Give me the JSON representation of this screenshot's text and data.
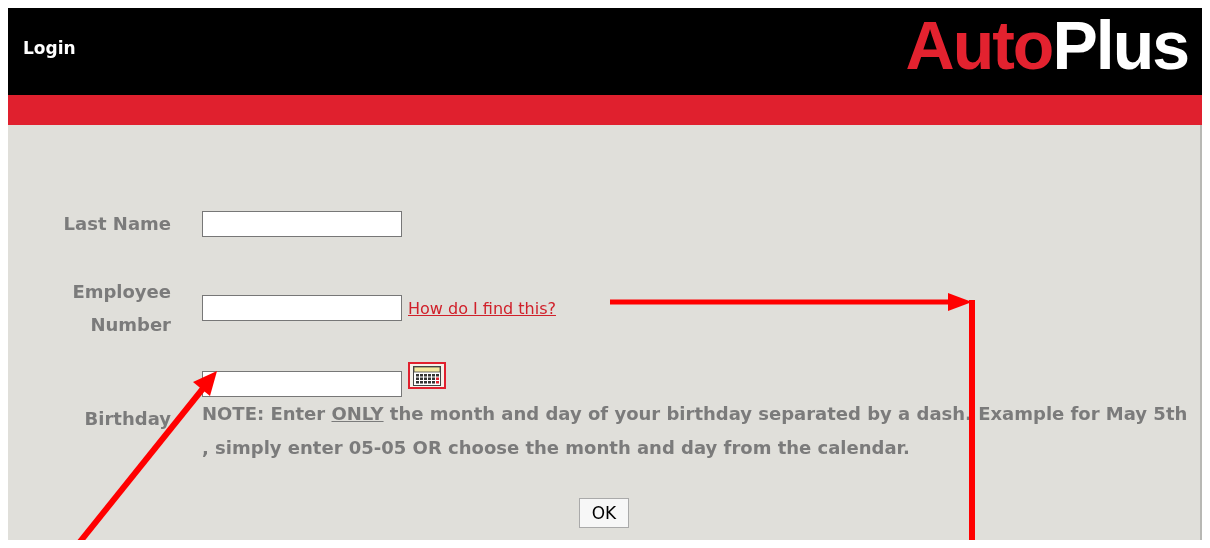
{
  "header": {
    "title": "Login",
    "logo": [
      {
        "text": "Auto",
        "color": "#e3222f"
      },
      {
        "text": "Plus",
        "color": "#ffffff"
      }
    ]
  },
  "form": {
    "fields": [
      {
        "kind": "text",
        "label": "Last Name"
      },
      {
        "kind": "link",
        "label": "Employee Number",
        "link": "How do I find this?"
      },
      {
        "kind": "date",
        "label": "Birthday",
        "note": [
          {
            "text": "NOTE: Enter ",
            "underline": false
          },
          {
            "text": "ONLY",
            "underline": true
          },
          {
            "text": " the month and day of your birthday separated by a dash. Example for May 5th , simply enter 05-05 OR choose the month and day from the calendar.",
            "underline": false
          }
        ]
      }
    ],
    "submit": "OK"
  }
}
